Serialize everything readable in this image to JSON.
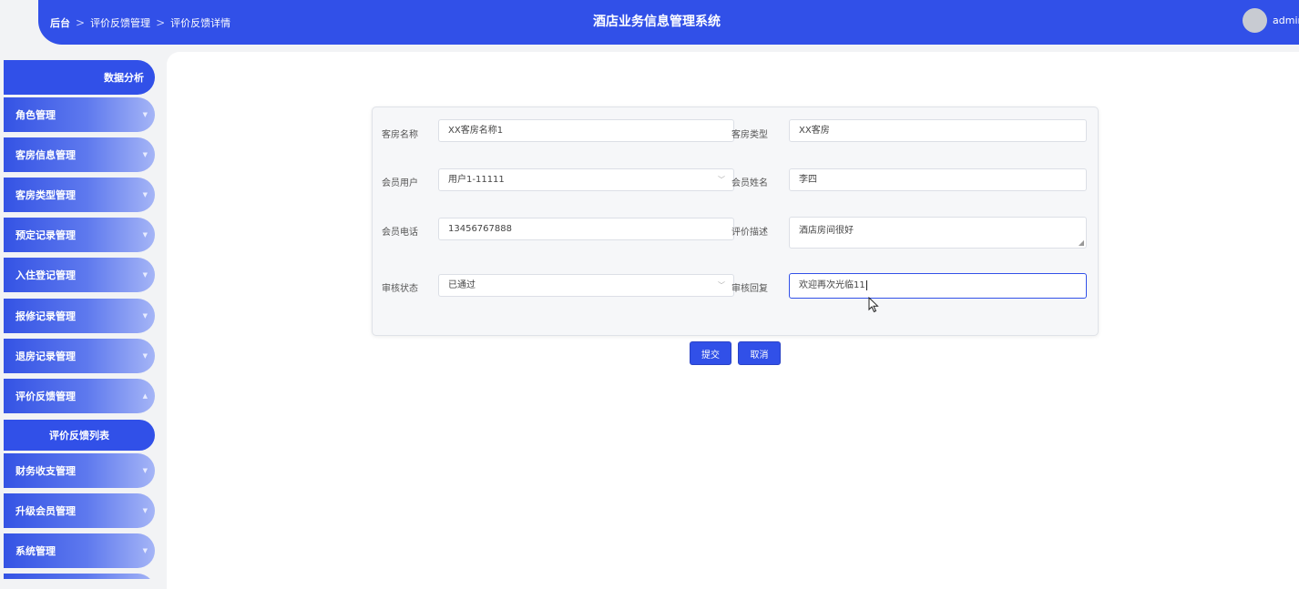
{
  "header": {
    "breadcrumb": [
      "后台",
      "评价反馈管理",
      "评价反馈详情"
    ],
    "separator": ">",
    "title": "酒店业务信息管理系统",
    "username": "admin"
  },
  "sidebar": {
    "items": [
      {
        "label": "数据分析"
      },
      {
        "label": "角色管理",
        "chevron": "▼"
      },
      {
        "label": "客房信息管理",
        "chevron": "▼"
      },
      {
        "label": "客房类型管理",
        "chevron": "▼"
      },
      {
        "label": "预定记录管理",
        "chevron": "▼"
      },
      {
        "label": "入住登记管理",
        "chevron": "▼"
      },
      {
        "label": "报修记录管理",
        "chevron": "▼"
      },
      {
        "label": "退房记录管理",
        "chevron": "▼"
      },
      {
        "label": "评价反馈管理",
        "chevron": "▲"
      },
      {
        "label": "评价反馈列表"
      },
      {
        "label": "财务收支管理",
        "chevron": "▼"
      },
      {
        "label": "升级会员管理",
        "chevron": "▼"
      },
      {
        "label": "系统管理",
        "chevron": "▼"
      }
    ]
  },
  "form": {
    "room_name": {
      "label": "客房名称",
      "value": "XX客房名称1"
    },
    "room_type": {
      "label": "客房类型",
      "value": "XX客房"
    },
    "member_user": {
      "label": "会员用户",
      "value": "用户1-11111"
    },
    "member_name": {
      "label": "会员姓名",
      "value": "李四"
    },
    "member_phone": {
      "label": "会员电话",
      "value": "13456767888"
    },
    "review_desc": {
      "label": "评价描述",
      "value": "酒店房间很好"
    },
    "audit_status": {
      "label": "审核状态",
      "value": "已通过"
    },
    "audit_reply": {
      "label": "审核回复",
      "value": "欢迎再次光临11"
    },
    "submit_label": "提交",
    "cancel_label": "取消"
  }
}
